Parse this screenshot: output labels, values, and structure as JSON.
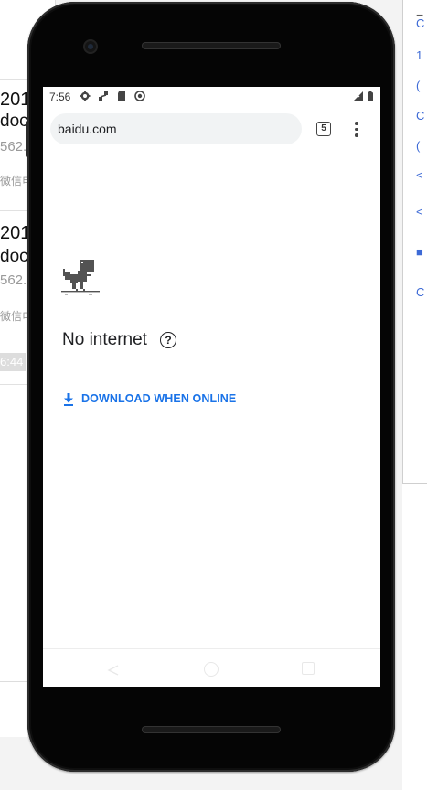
{
  "background_window": {
    "cards": [
      {
        "line1": "201",
        "line2": "doc",
        "line3": "562.",
        "line4": "微信电"
      },
      {
        "line1": "201",
        "line2": "doc",
        "line3": "562.",
        "line4": "微信电"
      }
    ],
    "time_badge": "6:44",
    "minimize_label": "−"
  },
  "status_bar": {
    "time": "7:56",
    "icons": [
      "settings-icon",
      "network-icon",
      "sd-card-icon",
      "sync-icon"
    ],
    "right_icons": [
      "signal-icon",
      "battery-icon"
    ]
  },
  "browser": {
    "url": "baidu.com",
    "tab_count": "5",
    "menu_icon": "more-vert-icon"
  },
  "page": {
    "heading": "No internet",
    "download_label": "DOWNLOAD WHEN ONLINE",
    "accent_color": "#1a73e8"
  },
  "nav_bar": {
    "buttons": [
      "back",
      "home",
      "recents"
    ]
  }
}
